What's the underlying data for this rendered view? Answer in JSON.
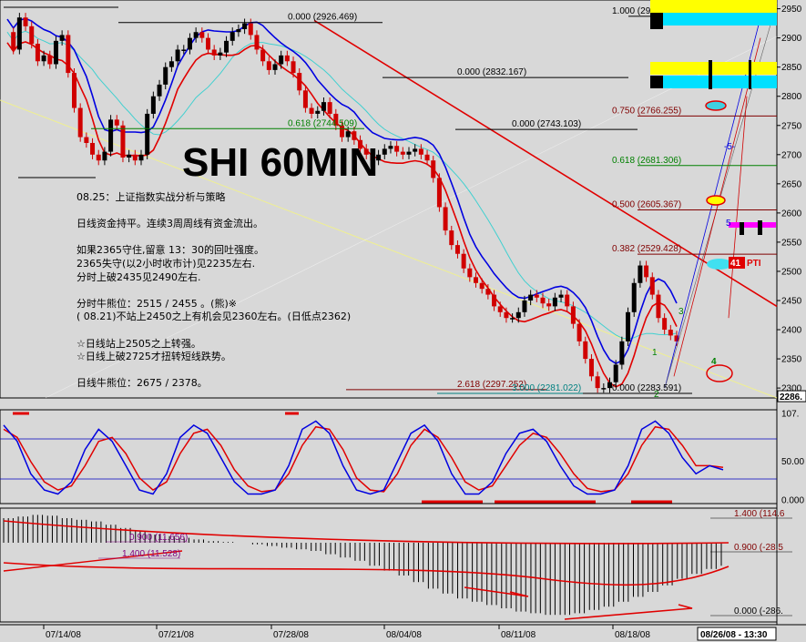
{
  "title": "SHI 60MIN",
  "notes": [
    "08.25：上证指数实战分析与策略",
    "",
    "日线资金持平。连续3周周线有资金流出。",
    "",
    "如果2365守住,留意 13：30的回吐强度。",
    "2365失守(以2小时收市计)见2235左右.",
    "分时上破2435见2490左右.",
    "",
    "分时牛熊位：2515 / 2455 。(熊)※",
    "( 08.21)不站上2450之上有机会见2360左右。(日低点2362)",
    "",
    "☆日线站上2505之上转强。",
    "☆日线上破2725才扭转短线跌势。",
    "",
    "日线牛熊位：2675 / 2378。"
  ],
  "chart_data": {
    "type": "line",
    "x_labels": [
      "07/14/08",
      "07/21/08",
      "07/28/08",
      "08/04/08",
      "08/11/08",
      "08/18/08",
      "08/26/08 - 13:30"
    ],
    "price_axis": {
      "ticks": [
        2950,
        2900,
        2850,
        2800,
        2750,
        2700,
        2650,
        2600,
        2550,
        2500,
        2450,
        2400,
        2350,
        2300
      ],
      "last": "2286.",
      "ylim": [
        2283,
        2965
      ]
    },
    "price_series": [
      2910,
      2880,
      2935,
      2920,
      2890,
      2860,
      2870,
      2855,
      2895,
      2905,
      2840,
      2780,
      2730,
      2720,
      2700,
      2690,
      2705,
      2760,
      2750,
      2695,
      2700,
      2690,
      2700,
      2770,
      2800,
      2820,
      2850,
      2860,
      2880,
      2880,
      2900,
      2910,
      2900,
      2880,
      2870,
      2875,
      2895,
      2910,
      2915,
      2925,
      2905,
      2880,
      2860,
      2845,
      2855,
      2870,
      2860,
      2840,
      2810,
      2780,
      2770,
      2775,
      2790,
      2770,
      2750,
      2730,
      2740,
      2725,
      2710,
      2700,
      2690,
      2700,
      2710,
      2715,
      2705,
      2700,
      2705,
      2710,
      2700,
      2690,
      2660,
      2610,
      2570,
      2545,
      2530,
      2505,
      2490,
      2480,
      2470,
      2460,
      2440,
      2430,
      2420,
      2420,
      2430,
      2450,
      2460,
      2455,
      2445,
      2440,
      2455,
      2460,
      2440,
      2410,
      2380,
      2350,
      2320,
      2300,
      2300,
      2310,
      2340,
      2380,
      2430,
      2480,
      2510,
      2490,
      2460,
      2420,
      2400,
      2390,
      2380
    ],
    "fib_levels": [
      {
        "label": "0.000 (2926.469)",
        "value": 2926.469
      },
      {
        "label": "0.000 (2832.167)",
        "value": 2832.167
      },
      {
        "label": "0.618 (2744.509)",
        "value": 2744.509
      },
      {
        "label": "0.000 (2743.103)",
        "value": 2743.103
      },
      {
        "label": "1.000 (2937.143)",
        "value": 2937.143
      },
      {
        "label": "0.750 (2766.255)",
        "value": 2766.255
      },
      {
        "label": "0.618 (2681.306)",
        "value": 2681.306
      },
      {
        "label": "0.500 (2605.367)",
        "value": 2605.367
      },
      {
        "label": "0.382 (2529.428)",
        "value": 2529.428
      },
      {
        "label": "2.618 (2297.252)",
        "value": 2297.252
      },
      {
        "label": "3.000 (2281.022)",
        "value": 2281.022
      },
      {
        "label": "0.000 (2283.591)",
        "value": 2283.591
      }
    ],
    "markers": {
      "pti": "PTI",
      "pti_num": "41",
      "wave_1": "1",
      "wave_2": "2",
      "wave_3": "3",
      "wave_4": "4",
      "wave_5": "-5-",
      "wave_5b": "5"
    },
    "stoch_axis": {
      "ticks": [
        "107.",
        "50.00",
        "0.000"
      ],
      "ylim": [
        0,
        107
      ]
    },
    "stoch_k": [
      90,
      70,
      30,
      10,
      5,
      20,
      60,
      85,
      70,
      40,
      10,
      5,
      30,
      75,
      90,
      80,
      50,
      20,
      5,
      5,
      10,
      40,
      85,
      95,
      80,
      40,
      10,
      5,
      10,
      45,
      80,
      90,
      70,
      30,
      5,
      5,
      20,
      55,
      80,
      85,
      70,
      40,
      15,
      5,
      5,
      10,
      40,
      85,
      95,
      80,
      50,
      30,
      40,
      35
    ],
    "stoch_d": [
      85,
      75,
      45,
      20,
      10,
      15,
      40,
      70,
      75,
      55,
      25,
      10,
      20,
      55,
      80,
      85,
      65,
      35,
      15,
      8,
      10,
      30,
      65,
      88,
      85,
      60,
      25,
      10,
      8,
      30,
      65,
      85,
      75,
      50,
      20,
      10,
      15,
      40,
      65,
      80,
      75,
      55,
      30,
      12,
      8,
      10,
      30,
      65,
      88,
      85,
      65,
      40,
      40,
      38
    ],
    "macd_labels": [
      {
        "label": "0.900 (11.656)",
        "value": 11.656
      },
      {
        "label": "1.400 (11.528)",
        "value": 11.528
      },
      {
        "label": "1.400 (114.6",
        "value": 114.6
      },
      {
        "label": "0.900 (-28.5",
        "value": -28.5
      },
      {
        "label": "0.000 (-286.",
        "value": -286
      }
    ],
    "macd_hist": [
      30,
      32,
      34,
      33,
      30,
      28,
      26,
      22,
      18,
      14,
      10,
      8,
      6,
      4,
      2,
      1,
      0,
      -2,
      -4,
      -6,
      -8,
      -10,
      -14,
      -18,
      -22,
      -28,
      -34,
      -40,
      -48,
      -56,
      -62,
      -68,
      -72,
      -76,
      -80,
      -84,
      -86,
      -88,
      -88,
      -86,
      -82,
      -78,
      -72,
      -66,
      -60,
      -52,
      -44,
      -38,
      -32,
      -28
    ]
  },
  "colors": {
    "price_up": "#d00000",
    "price_down": "#000000",
    "upper_band": "#0000e0",
    "lower_band": "#e00000",
    "ma_cyan": "#40d0d0",
    "trend_line": "#e00000",
    "bg": "#d8d8d8",
    "accent_yellow": "#ffff00",
    "accent_cyan": "#00e0ff",
    "accent_magenta": "#ff00ff"
  }
}
